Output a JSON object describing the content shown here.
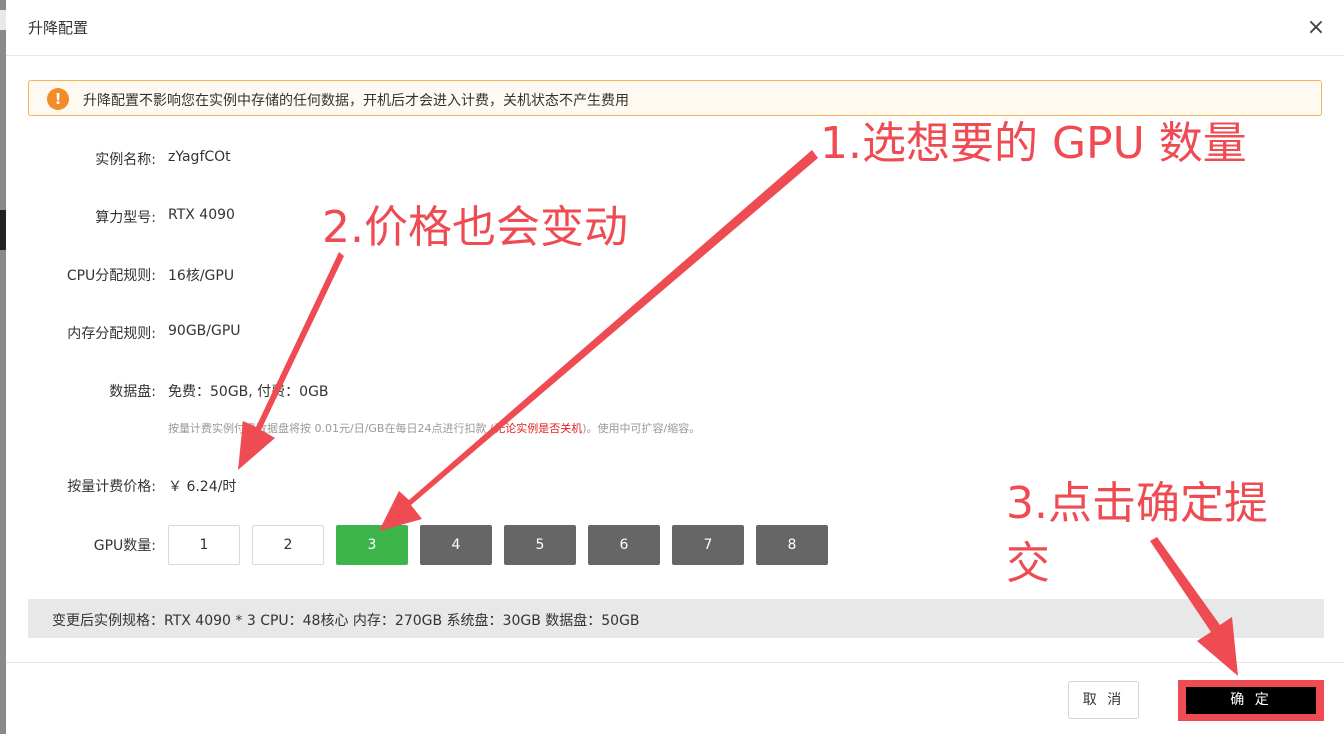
{
  "dialog": {
    "title": "升降配置",
    "close_label": "×"
  },
  "notice": {
    "icon": "!",
    "text": "升降配置不影响您在实例中存储的任何数据，开机后才会进入计费，关机状态不产生费用"
  },
  "fields": {
    "instance_name": {
      "label": "实例名称:",
      "value": "zYagfCOt"
    },
    "gpu_model": {
      "label": "算力型号:",
      "value": "RTX 4090"
    },
    "cpu_rule": {
      "label": "CPU分配规则:",
      "value": "16核/GPU"
    },
    "memory_rule": {
      "label": "内存分配规则:",
      "value": "90GB/GPU"
    },
    "data_disk": {
      "label": "数据盘:",
      "value": "免费：50GB, 付费：0GB"
    },
    "price": {
      "label": "按量计费价格:",
      "value": "￥ 6.24/时"
    },
    "gpu_count": {
      "label": "GPU数量:"
    }
  },
  "disk_note": {
    "before": "按量计费实例付费数据盘将按 0.01元/日/GB在每日24点进行扣款 (",
    "warning": "无论实例是否关机",
    "after": ")。使用中可扩容/缩容。"
  },
  "gpu_options": [
    {
      "label": "1",
      "state": "available"
    },
    {
      "label": "2",
      "state": "available"
    },
    {
      "label": "3",
      "state": "selected"
    },
    {
      "label": "4",
      "state": "unavailable"
    },
    {
      "label": "5",
      "state": "unavailable"
    },
    {
      "label": "6",
      "state": "unavailable"
    },
    {
      "label": "7",
      "state": "unavailable"
    },
    {
      "label": "8",
      "state": "unavailable"
    }
  ],
  "spec_summary": "变更后实例规格：RTX 4090 * 3 CPU：48核心 内存：270GB 系统盘：30GB 数据盘：50GB",
  "buttons": {
    "cancel": "取 消",
    "confirm": "确 定"
  },
  "annotations": {
    "step1": "1.选想要的 GPU 数量",
    "step2": "2.价格也会变动",
    "step3_line1": "3.点击确定提",
    "step3_line2": "交"
  },
  "colors": {
    "selected_green": "#3db54a",
    "unavailable_gray": "#666666",
    "annotation_red": "#ef4b52",
    "notice_orange": "#f28c28"
  }
}
